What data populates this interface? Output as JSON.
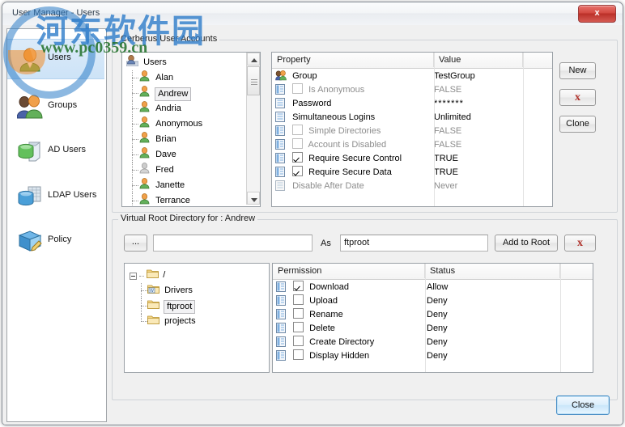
{
  "window": {
    "title": "User Manager - Users",
    "close_button": "x"
  },
  "sidebar": {
    "items": [
      {
        "label": "Users",
        "icon": "user-icon",
        "selected": true
      },
      {
        "label": "Groups",
        "icon": "groups-icon",
        "selected": false
      },
      {
        "label": "AD Users",
        "icon": "database-green-icon",
        "selected": false
      },
      {
        "label": "LDAP Users",
        "icon": "database-blue-icon",
        "selected": false
      },
      {
        "label": "Policy",
        "icon": "policy-book-icon",
        "selected": false
      }
    ]
  },
  "accounts_group": {
    "label": "Cerberus User Accounts",
    "tree": {
      "root": {
        "label": "Users",
        "icon": "users-root-icon"
      },
      "nodes": [
        {
          "label": "Alan",
          "icon": "user-icon",
          "selected": false,
          "disabled": false
        },
        {
          "label": "Andrew",
          "icon": "user-icon",
          "selected": true,
          "disabled": false
        },
        {
          "label": "Andria",
          "icon": "user-icon",
          "selected": false,
          "disabled": false
        },
        {
          "label": "Anonymous",
          "icon": "user-icon",
          "selected": false,
          "disabled": false
        },
        {
          "label": "Brian",
          "icon": "user-icon",
          "selected": false,
          "disabled": false
        },
        {
          "label": "Dave",
          "icon": "user-icon",
          "selected": false,
          "disabled": false
        },
        {
          "label": "Fred",
          "icon": "user-icon-disabled",
          "selected": false,
          "disabled": true
        },
        {
          "label": "Janette",
          "icon": "user-icon",
          "selected": false,
          "disabled": false
        },
        {
          "label": "Terrance",
          "icon": "user-icon",
          "selected": false,
          "disabled": false
        }
      ]
    },
    "properties_grid": {
      "columns": [
        "Property",
        "Value",
        ""
      ],
      "rows": [
        {
          "icon": "group-icon",
          "checkbox": "none",
          "property": "Group",
          "value": "TestGroup",
          "dim": false
        },
        {
          "icon": "property-icon",
          "checkbox": "unchecked",
          "property": "Is Anonymous",
          "value": "FALSE",
          "dim": true
        },
        {
          "icon": "property-icon",
          "checkbox": "none",
          "property": "Password",
          "value": "*******",
          "dim": false
        },
        {
          "icon": "property-icon",
          "checkbox": "none",
          "property": "Simultaneous Logins",
          "value": "Unlimited",
          "dim": false
        },
        {
          "icon": "property-icon",
          "checkbox": "unchecked",
          "property": "Simple Directories",
          "value": "FALSE",
          "dim": true
        },
        {
          "icon": "property-icon",
          "checkbox": "unchecked",
          "property": "Account is Disabled",
          "value": "FALSE",
          "dim": true
        },
        {
          "icon": "property-icon",
          "checkbox": "checked",
          "property": "Require Secure Control",
          "value": "TRUE",
          "dim": false
        },
        {
          "icon": "property-icon",
          "checkbox": "checked",
          "property": "Require Secure Data",
          "value": "TRUE",
          "dim": false
        },
        {
          "icon": "property-icon",
          "checkbox": "none",
          "property": "Disable After Date",
          "value": "Never",
          "dim": true
        }
      ]
    },
    "buttons": {
      "new": "New",
      "delete": "x",
      "clone": "Clone"
    }
  },
  "virtual_root_group": {
    "label": "Virtual Root Directory for : Andrew",
    "browse_button": "...",
    "path_value": "",
    "path_placeholder": "",
    "as_label": "As",
    "alias_value": "ftproot",
    "add_button": "Add to Root",
    "remove_button": "x",
    "folder_tree": {
      "root": {
        "label": "/",
        "icon": "folder-icon",
        "expander": "minus"
      },
      "nodes": [
        {
          "label": "Drivers",
          "icon": "folder-special-icon",
          "selected": false
        },
        {
          "label": "ftproot",
          "icon": "folder-icon",
          "selected": true
        },
        {
          "label": "projects",
          "icon": "folder-icon",
          "selected": false
        }
      ]
    },
    "permissions_grid": {
      "columns": [
        "Permission",
        "Status",
        ""
      ],
      "rows": [
        {
          "icon": "property-icon",
          "checkbox": "checked",
          "permission": "Download",
          "status": "Allow"
        },
        {
          "icon": "property-icon",
          "checkbox": "unchecked",
          "permission": "Upload",
          "status": "Deny"
        },
        {
          "icon": "property-icon",
          "checkbox": "unchecked",
          "permission": "Rename",
          "status": "Deny"
        },
        {
          "icon": "property-icon",
          "checkbox": "unchecked",
          "permission": "Delete",
          "status": "Deny"
        },
        {
          "icon": "property-icon",
          "checkbox": "unchecked",
          "permission": "Create Directory",
          "status": "Deny"
        },
        {
          "icon": "property-icon",
          "checkbox": "unchecked",
          "permission": "Display Hidden",
          "status": "Deny"
        }
      ]
    }
  },
  "footer": {
    "close_label": "Close"
  },
  "watermark": {
    "site_cn": "河东软件园",
    "site_url": "www.pc0359.cn"
  },
  "colors": {
    "selection": "#cde3f7",
    "close_red": "#bb2f28",
    "default_button_border": "#4a8fc6",
    "x_icon": "#b0332c"
  }
}
